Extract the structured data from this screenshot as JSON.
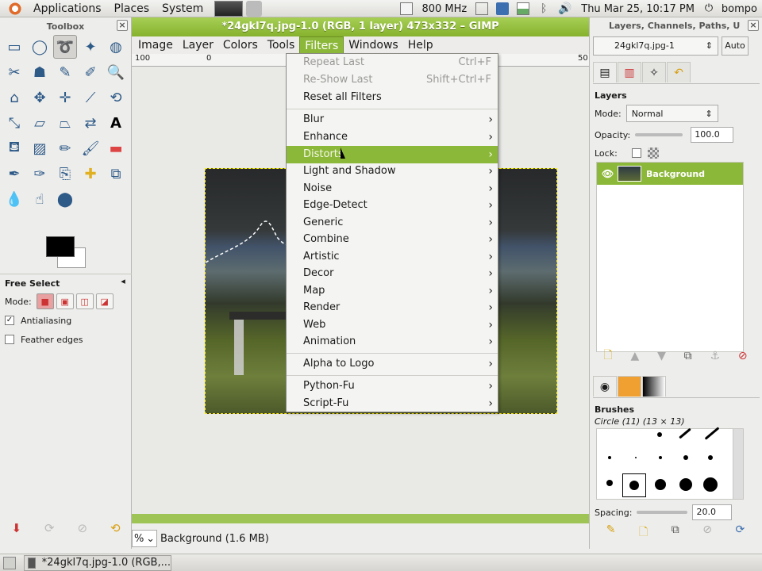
{
  "top_panel": {
    "applications": "Applications",
    "places": "Places",
    "system": "System",
    "cpu_freq": "800 MHz",
    "datetime": "Thu Mar 25, 10:17 PM",
    "user": "bompo"
  },
  "toolbox": {
    "title": "Toolbox",
    "tool_options_title": "Free Select",
    "mode_label": "Mode:",
    "antialiasing_label": "Antialiasing",
    "antialiasing_checked": true,
    "feather_label": "Feather edges",
    "feather_checked": false
  },
  "image_window": {
    "title": "*24gkl7q.jpg-1.0 (RGB, 1 layer) 473x332 – GIMP",
    "menus": [
      "Image",
      "Layer",
      "Colors",
      "Tools",
      "Filters",
      "Windows",
      "Help"
    ],
    "ruler_labels": [
      "100",
      "0",
      "50"
    ],
    "zoom_unit": "%",
    "status_text": "Background (1.6 MB)"
  },
  "filters_menu": {
    "repeat_last": "Repeat Last",
    "repeat_last_accel": "Ctrl+F",
    "reshow_last": "Re-Show Last",
    "reshow_last_accel": "Shift+Ctrl+F",
    "reset_all": "Reset all Filters",
    "items": [
      "Blur",
      "Enhance",
      "Distorts",
      "Light and Shadow",
      "Noise",
      "Edge-Detect",
      "Generic",
      "Combine",
      "Artistic",
      "Decor",
      "Map",
      "Render",
      "Web",
      "Animation"
    ],
    "alpha_to_logo": "Alpha to Logo",
    "python_fu": "Python-Fu",
    "script_fu": "Script-Fu",
    "highlighted": "Distorts"
  },
  "layers_dock": {
    "title": "Layers, Channels, Paths, U",
    "image_select": "24gkl7q.jpg-1",
    "auto_label": "Auto",
    "layers_header": "Layers",
    "mode_label": "Mode:",
    "mode_value": "Normal",
    "opacity_label": "Opacity:",
    "opacity_value": "100.0",
    "lock_label": "Lock:",
    "layer_name": "Background",
    "brushes_header": "Brushes",
    "brush_name": "Circle (11) (13 × 13)",
    "spacing_label": "Spacing:",
    "spacing_value": "20.0"
  },
  "taskbar": {
    "task_label": "*24gkl7q.jpg-1.0 (RGB,..."
  },
  "colors": {
    "accent": "#8cb83a",
    "title_bar": "#9ec455",
    "foreground": "#000000",
    "background": "#ffffff"
  }
}
